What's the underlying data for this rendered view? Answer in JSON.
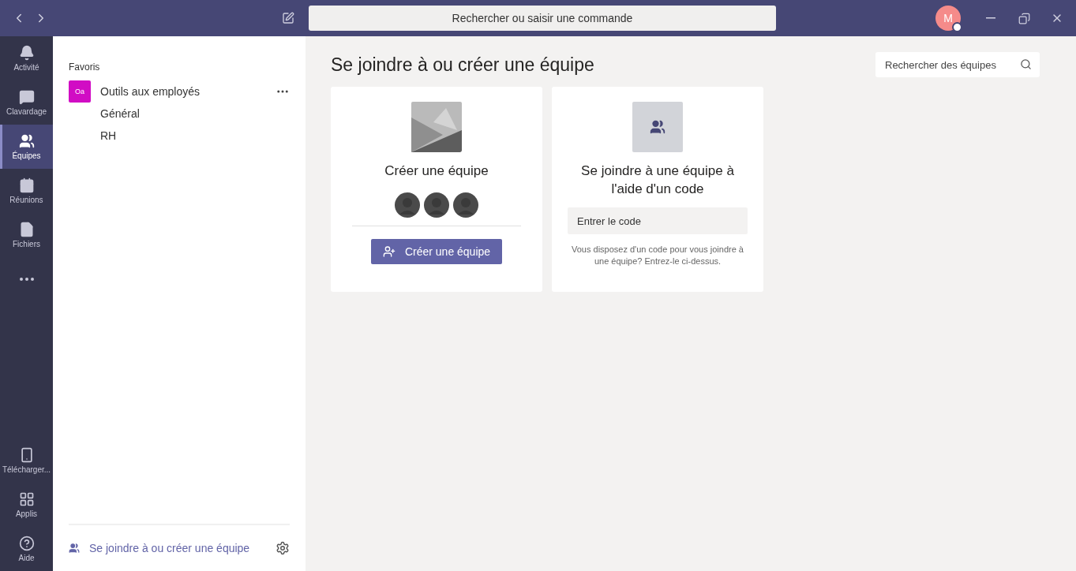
{
  "titlebar": {
    "search": {
      "placeholder": "Rechercher ou saisir une commande"
    },
    "avatar": {
      "initial": "M"
    }
  },
  "rail": {
    "items": [
      {
        "kind": "bell",
        "label": "Activité",
        "selected": false
      },
      {
        "kind": "chat",
        "label": "Clavardage",
        "selected": false
      },
      {
        "kind": "teams",
        "label": "Équipes",
        "selected": true
      },
      {
        "kind": "calendar",
        "label": "Réunions",
        "selected": false
      },
      {
        "kind": "file",
        "label": "Fichiers",
        "selected": false
      },
      {
        "kind": "more",
        "selected": false
      }
    ],
    "bottom_items": [
      {
        "kind": "phone",
        "label": "Télécharger...",
        "selected": false
      },
      {
        "kind": "apps",
        "label": "Applis",
        "selected": false
      },
      {
        "kind": "help",
        "label": "Aide",
        "selected": false
      }
    ]
  },
  "sidebar": {
    "section": "Favoris",
    "teams": [
      {
        "badge": "Oa",
        "color": "#d10cc4",
        "name": "Outils aux employés",
        "channels": [
          "Général",
          "RH"
        ]
      }
    ],
    "footer_link": "Se joindre à ou créer une équipe"
  },
  "main": {
    "title": "Se joindre à ou créer une équipe",
    "search": {
      "placeholder": "Rechercher des équipes"
    },
    "create_card": {
      "title": "Créer une équipe",
      "button": "Créer une équipe"
    },
    "join_card": {
      "title": "Se joindre à une équipe à l'aide d'un code",
      "field": {
        "placeholder": "Entrer le code"
      },
      "hint": "Vous disposez d'un code pour vous joindre à une équipe? Entrez-le ci-dessus."
    }
  }
}
